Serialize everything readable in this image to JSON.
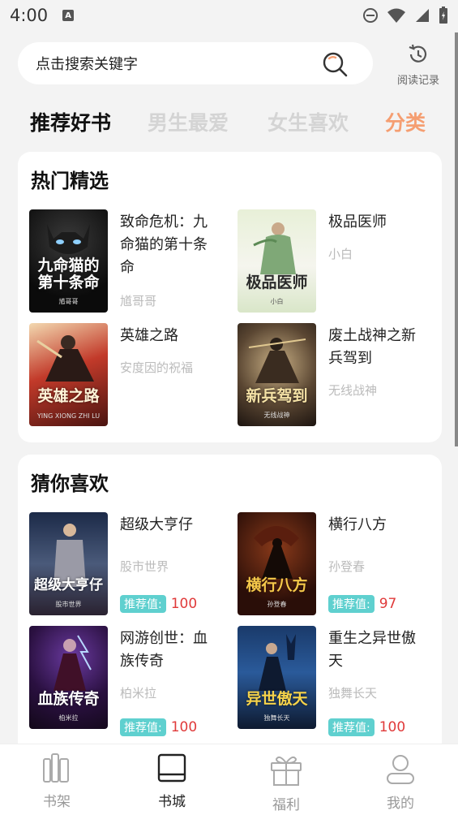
{
  "status_bar": {
    "time": "4:00",
    "a_badge": "A"
  },
  "search": {
    "placeholder": "点击搜索关键字",
    "history_label": "阅读记录"
  },
  "tabs": [
    {
      "label": "推荐好书",
      "active": true
    },
    {
      "label": "男生最爱",
      "active": false
    },
    {
      "label": "女生喜欢",
      "active": false
    },
    {
      "label": "分类",
      "accent": "#f59e71"
    }
  ],
  "hot_section": {
    "title": "热门精选",
    "books": [
      {
        "title": "致命危机：九命猫的第十条命",
        "author": "馗哥哥",
        "cover_text": "九命猫的第十条命",
        "cover_author": "馗哥哥"
      },
      {
        "title": "极品医师",
        "author": "小白",
        "cover_text": "极品医师",
        "cover_author": "小白"
      },
      {
        "title": "英雄之路",
        "author": "安度因的祝福",
        "cover_text": "英雄之路",
        "cover_author": "YING XIONG ZHI LU"
      },
      {
        "title": "废土战神之新兵驾到",
        "author": "无线战神",
        "cover_text": "新兵驾到",
        "cover_author": "无线战神"
      }
    ]
  },
  "guess_section": {
    "title": "猜你喜欢",
    "score_label": "推荐值:",
    "books": [
      {
        "title": "超级大亨仔",
        "author": "股市世界",
        "score": "100",
        "cover_text": "超级大亨仔",
        "cover_author": "股市世界"
      },
      {
        "title": "横行八方",
        "author": "孙登春",
        "score": "97",
        "cover_text": "横行八方",
        "cover_author": "孙登春"
      },
      {
        "title": "网游创世：血族传奇",
        "author": "柏米拉",
        "score": "100",
        "cover_text": "血族传奇",
        "cover_author": "柏米拉"
      },
      {
        "title": "重生之异世傲天",
        "author": "独舞长天",
        "score": "100",
        "cover_text": "异世傲天",
        "cover_author": "独舞长天"
      }
    ]
  },
  "bottom_nav": [
    {
      "label": "书架",
      "icon": "bookshelf-icon",
      "active": false
    },
    {
      "label": "书城",
      "icon": "book-icon",
      "active": true
    },
    {
      "label": "福利",
      "icon": "gift-icon",
      "active": false
    },
    {
      "label": "我的",
      "icon": "user-icon",
      "active": false
    }
  ],
  "colors": {
    "accent": "#f59e71",
    "score_badge": "#5fd0cf",
    "score_value": "#e03a3a"
  }
}
